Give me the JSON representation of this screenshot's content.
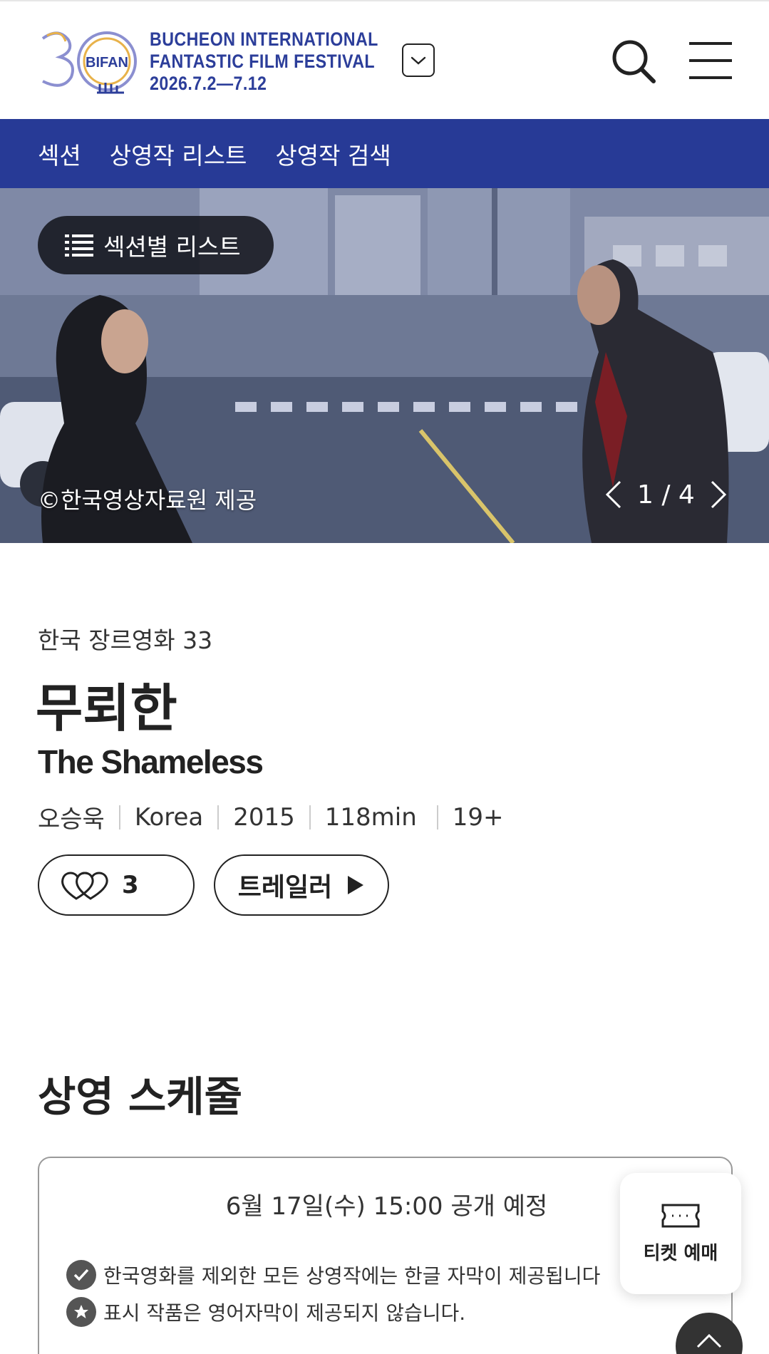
{
  "header": {
    "logo_number": "30",
    "logo_mark": "BIFAN",
    "festival_line1": "BUCHEON INTERNATIONAL",
    "festival_line2": "FANTASTIC FILM FESTIVAL",
    "festival_dates": "2026.7.2—7.12",
    "brand_color": "#2c3e9a"
  },
  "subnav": {
    "bg_color": "#273a96",
    "items": [
      "섹션",
      "상영작 리스트",
      "상영작 검색"
    ]
  },
  "hero": {
    "section_list_label": "섹션별 리스트",
    "credit": "©한국영상자료원 제공",
    "pager": "1 / 4"
  },
  "film": {
    "section": "한국 장르영화 33",
    "title_ko": "무뢰한",
    "title_en": "The Shameless",
    "director": "오승욱",
    "country": "Korea",
    "year": "2015",
    "runtime": "118min",
    "rating": "19+",
    "like_count": "3",
    "trailer_label": "트레일러"
  },
  "schedule": {
    "title": "상영 스케줄",
    "open_date": "6월 17일(수) 15:00 공개 예정",
    "note1": "한국영화를 제외한 모든 상영작에는 한글 자막이 제공됩니다",
    "note2": "표시 작품은 영어자막이 제공되지 않습니다."
  },
  "floating": {
    "ticket_label": "티켓 예매"
  },
  "icons": [
    "logo-emblem",
    "chevron-down-icon",
    "search-icon",
    "menu-icon",
    "list-icon",
    "chevron-left-icon",
    "chevron-right-icon",
    "heart-outline-icon",
    "play-icon",
    "check-badge-icon",
    "star-badge-icon",
    "ticket-icon",
    "chevron-up-icon"
  ]
}
